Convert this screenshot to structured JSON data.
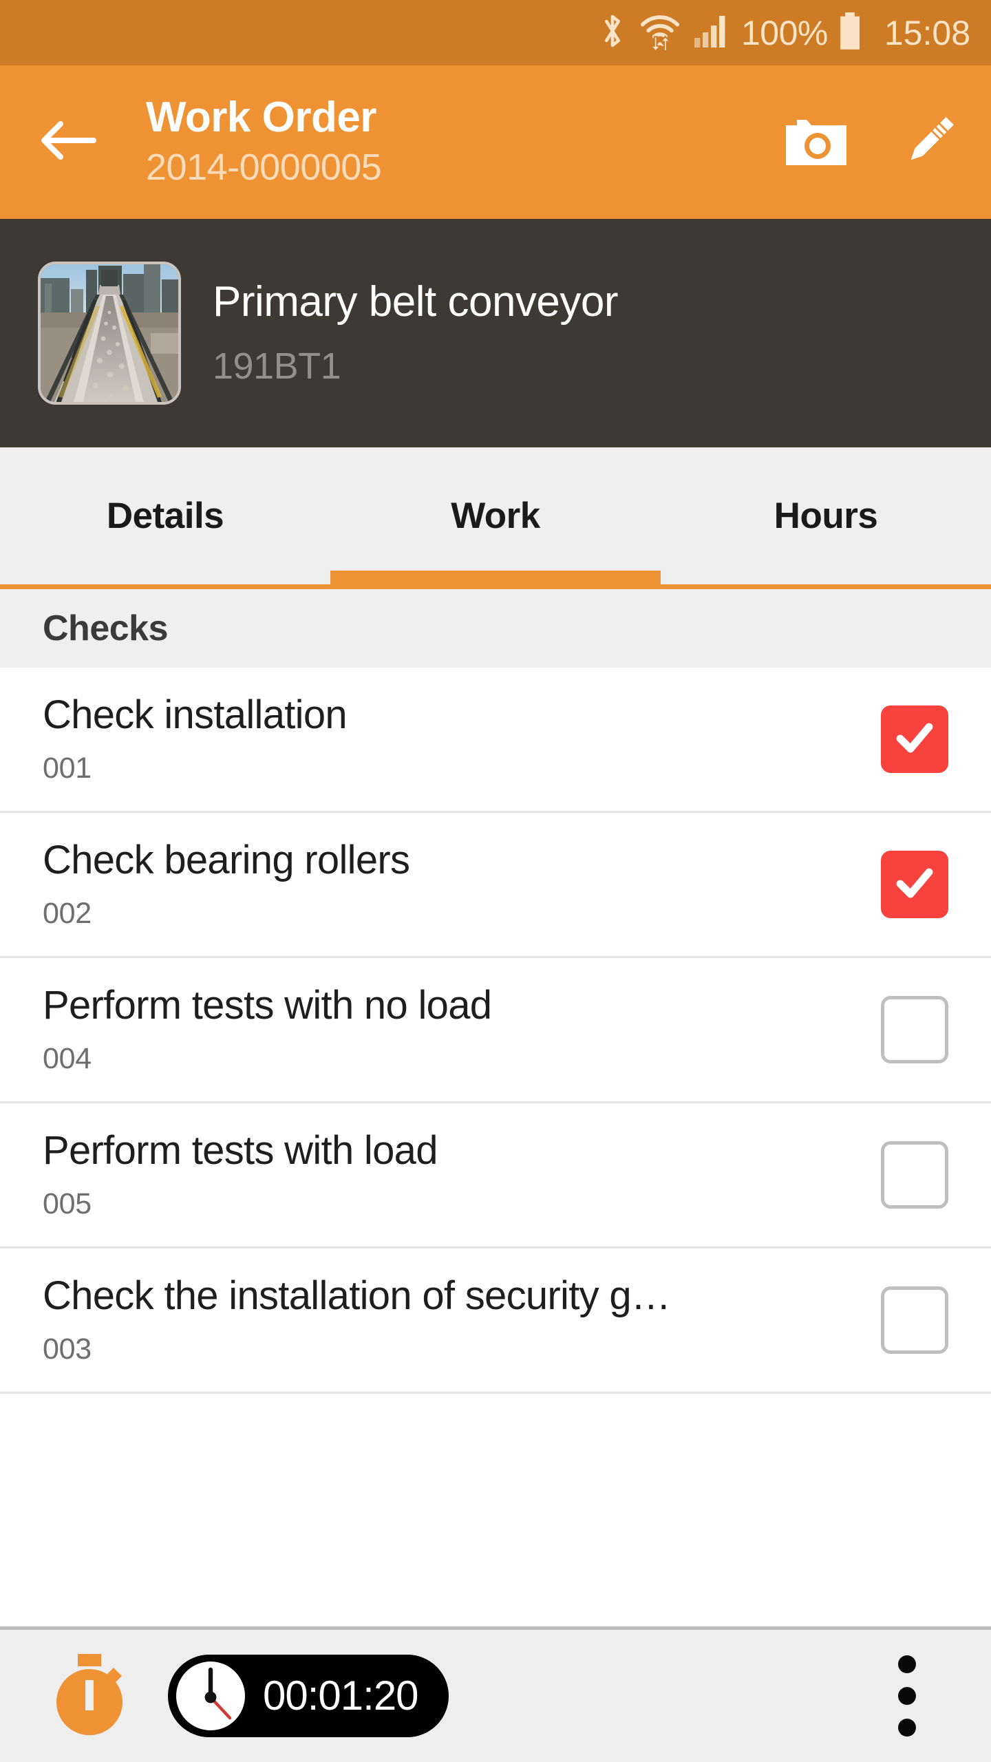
{
  "status_bar": {
    "background": "#CE7B26",
    "battery_percent": "100%",
    "time": "15:08",
    "icons": [
      "bluetooth-icon",
      "wifi-icon",
      "signal-icon",
      "battery-icon"
    ]
  },
  "app_bar": {
    "background": "#EF9234",
    "back_label": "back-arrow-icon",
    "title": "Work Order",
    "subtitle": "2014-0000005",
    "actions": [
      {
        "name": "camera-button",
        "label": "camera-icon"
      },
      {
        "name": "edit-button",
        "label": "pencil-icon"
      }
    ]
  },
  "asset": {
    "background": "#3D3A35",
    "name": "Primary belt conveyor",
    "code": "191BT1",
    "thumbnail": "belt-conveyor-photo"
  },
  "tabs": {
    "active_index": 1,
    "accent": "#EF9234",
    "items": [
      {
        "label": "Details"
      },
      {
        "label": "Work"
      },
      {
        "label": "Hours"
      }
    ]
  },
  "section": {
    "title": "Checks"
  },
  "checks": [
    {
      "title": "Check installation",
      "code": "001",
      "checked": true
    },
    {
      "title": "Check bearing rollers",
      "code": "002",
      "checked": true
    },
    {
      "title": "Perform tests with no load",
      "code": "004",
      "checked": false
    },
    {
      "title": "Perform tests with load",
      "code": "005",
      "checked": false
    },
    {
      "title": "Check the installation of security g…",
      "code": "003",
      "checked": false
    }
  ],
  "bottom_bar": {
    "background": "#EEEEEE",
    "stopwatch_label": "stopwatch-icon",
    "timer_value": "00:01:20",
    "overflow_label": "more-vertical-icon",
    "checked_color": "#F8423D"
  }
}
